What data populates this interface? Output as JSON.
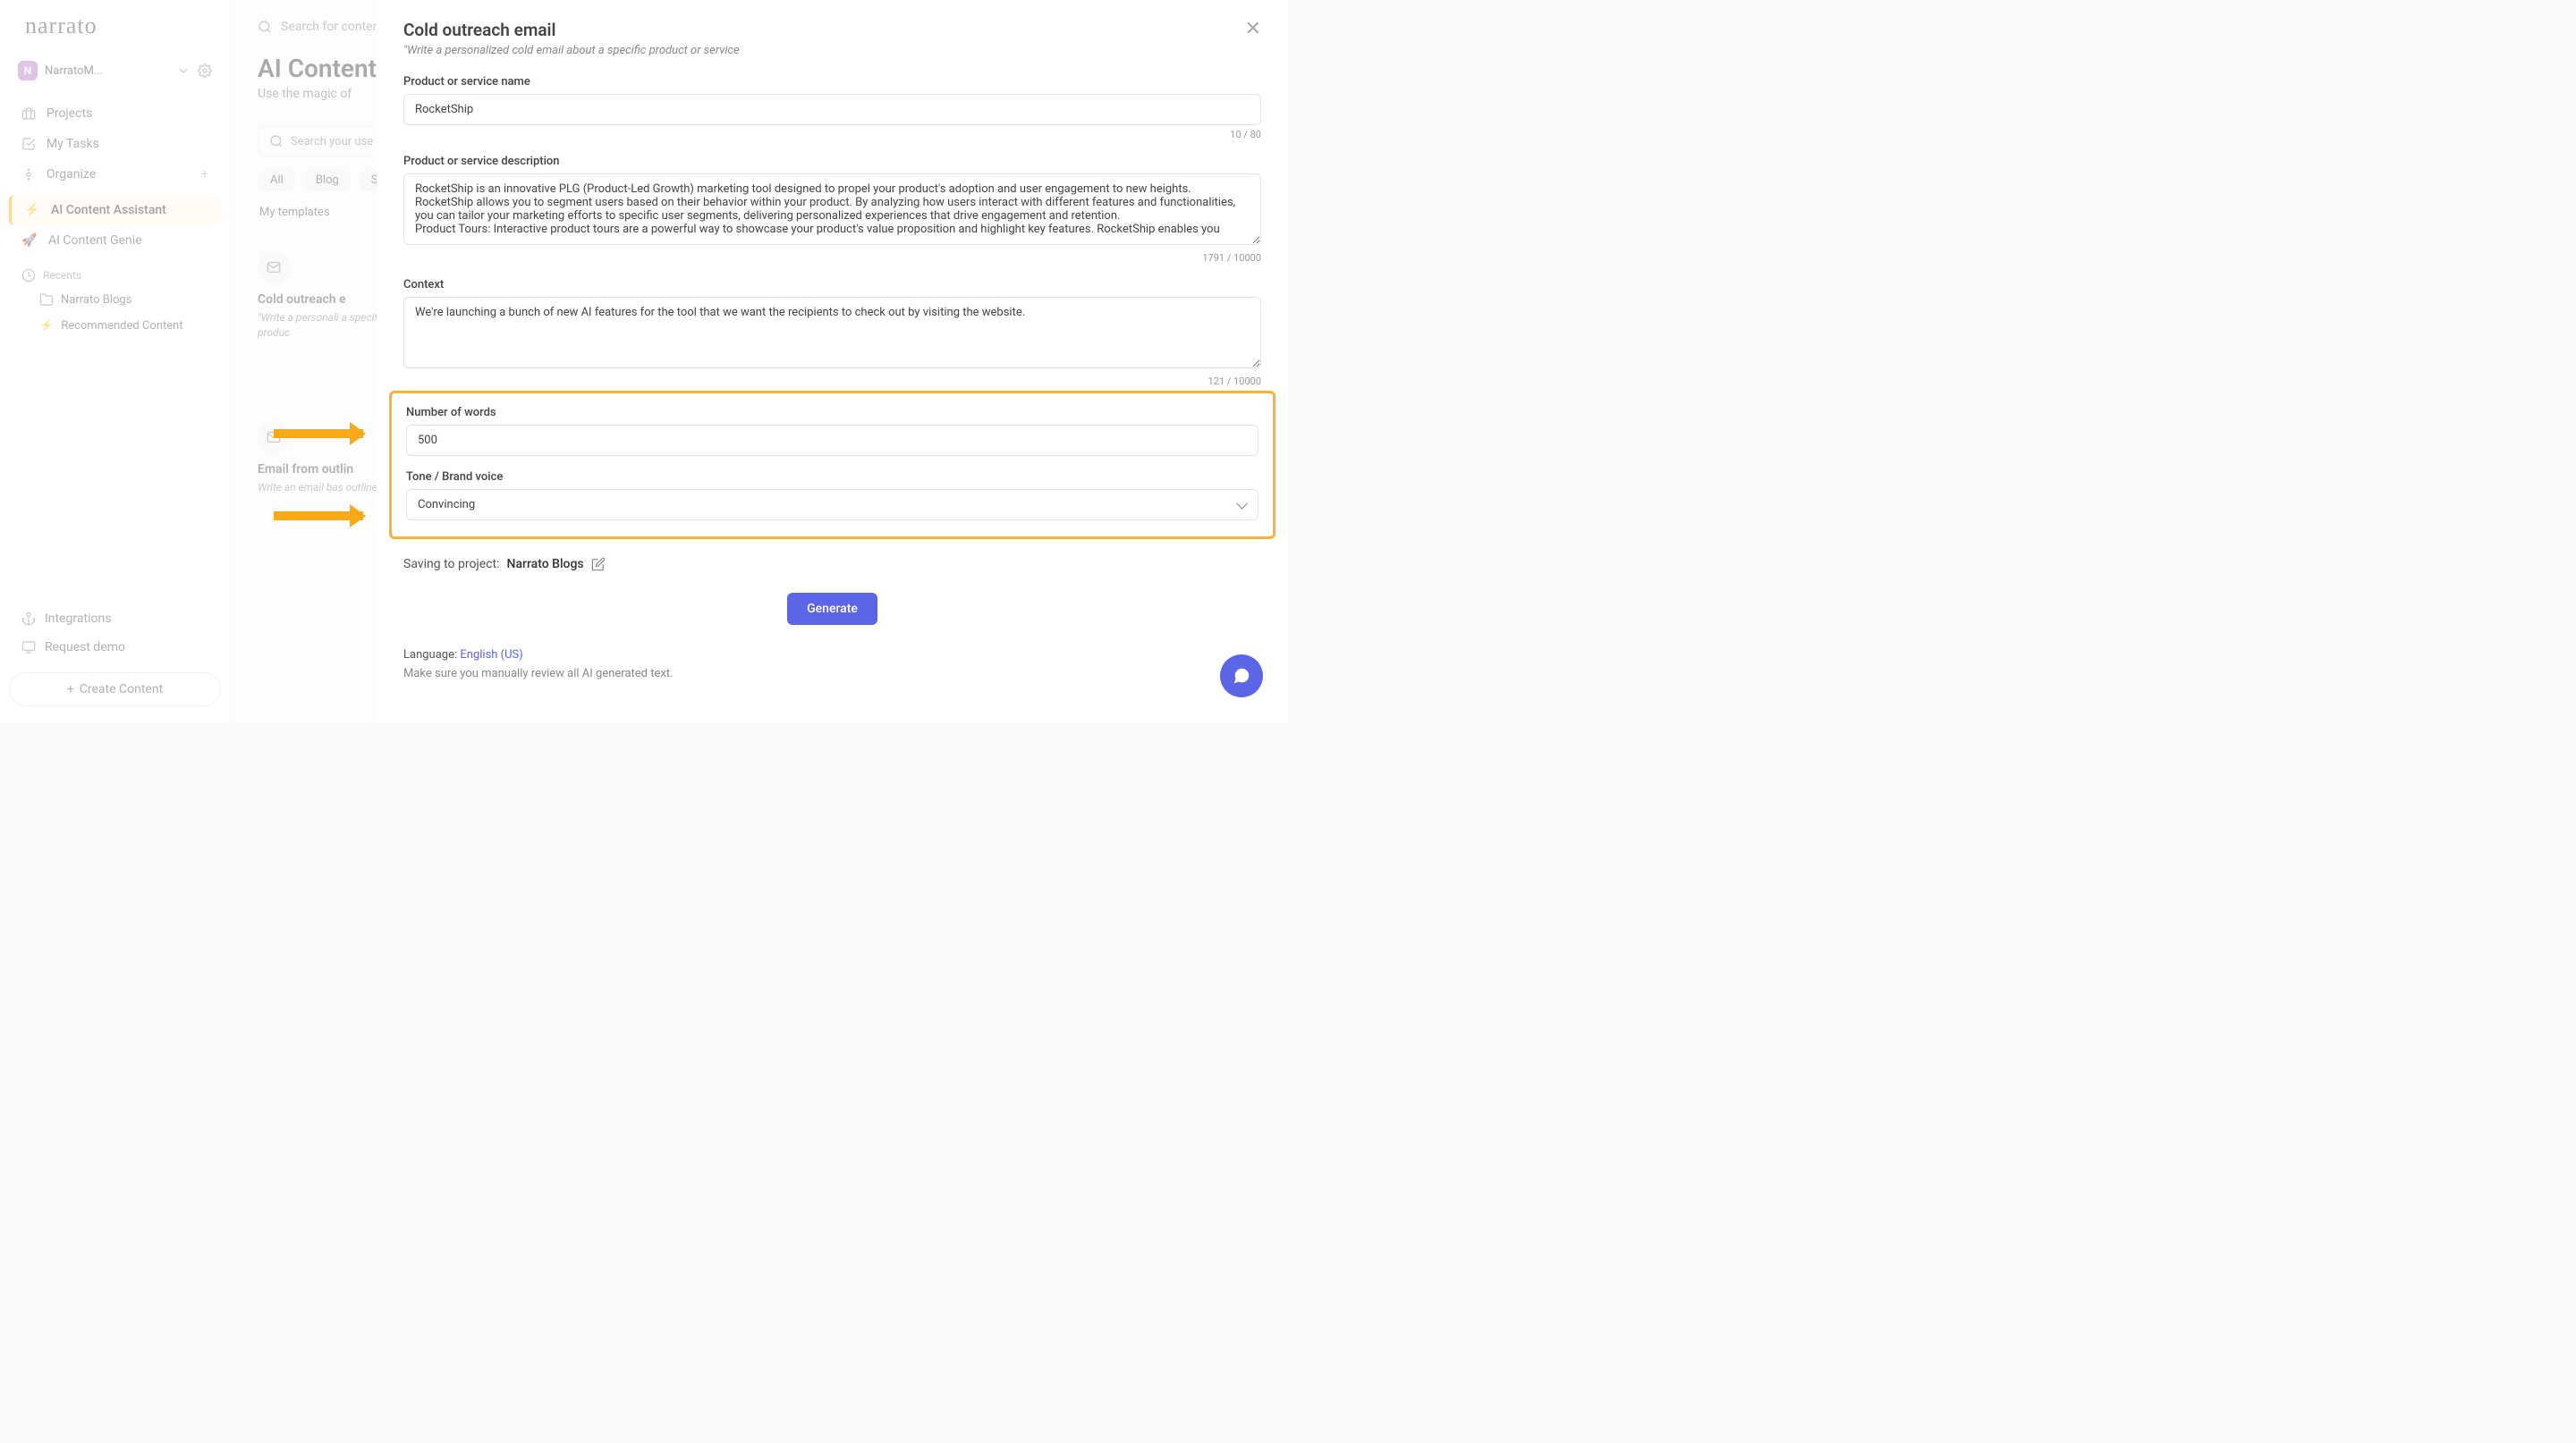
{
  "logo_text": "narrato",
  "workspace": {
    "badge": "N",
    "name": "NarratoM..."
  },
  "sidebar": {
    "main_items": [
      {
        "icon": "briefcase",
        "label": "Projects"
      },
      {
        "icon": "check",
        "label": "My Tasks"
      },
      {
        "icon": "sliders",
        "label": "Organize"
      }
    ],
    "ai_items": [
      {
        "emoji": "⚡",
        "label": "AI Content Assistant",
        "active": true
      },
      {
        "emoji": "🚀",
        "label": "AI Content Genie"
      }
    ],
    "recents_header": "Recents",
    "recents": [
      {
        "icon": "folder",
        "label": "Narrato Blogs"
      },
      {
        "icon": "⚡",
        "label": "Recommended Content"
      }
    ],
    "bottom": [
      {
        "icon": "anchor",
        "label": "Integrations"
      },
      {
        "icon": "monitor",
        "label": "Request demo"
      }
    ],
    "create_button": "Create Content"
  },
  "main": {
    "search_placeholder": "Search for content",
    "heading": "AI Content",
    "subhead": "Use the magic of",
    "usecase_search_placeholder": "Search your use",
    "pills": [
      "All",
      "Blog",
      "S"
    ],
    "templates_link": "My templates",
    "cards": [
      {
        "title": "Cold outreach e",
        "desc": "\"Write a personali a specific produc"
      },
      {
        "title": "Email from outlin",
        "desc": "Write an email bas outline"
      }
    ]
  },
  "modal": {
    "title": "Cold outreach email",
    "subtitle": "\"Write a personalized cold email about a specific product or service",
    "fields": {
      "product_name_label": "Product or service name",
      "product_name_value": "RocketShip",
      "product_name_counter": "10 / 80",
      "product_desc_label": "Product or service description",
      "product_desc_value": "RocketShip is an innovative PLG (Product-Led Growth) marketing tool designed to propel your product's adoption and user engagement to new heights. RocketShip allows you to segment users based on their behavior within your product. By analyzing how users interact with different features and functionalities, you can tailor your marketing efforts to specific user segments, delivering personalized experiences that drive engagement and retention.\nProduct Tours: Interactive product tours are a powerful way to showcase your product's value proposition and highlight key features. RocketShip enables you",
      "product_desc_counter": "1791 / 10000",
      "context_label": "Context",
      "context_value": "We're launching a bunch of new AI features for the tool that we want the recipients to check out by visiting the website.",
      "context_counter": "121 / 10000",
      "words_label": "Number of words",
      "words_value": "500",
      "tone_label": "Tone / Brand voice",
      "tone_value": "Convincing"
    },
    "save_label": "Saving to project:",
    "save_project": "Narrato Blogs",
    "generate_button": "Generate",
    "language_label": "Language:",
    "language_value": "English (US)",
    "review_note": "Make sure you manually review all AI generated text."
  }
}
